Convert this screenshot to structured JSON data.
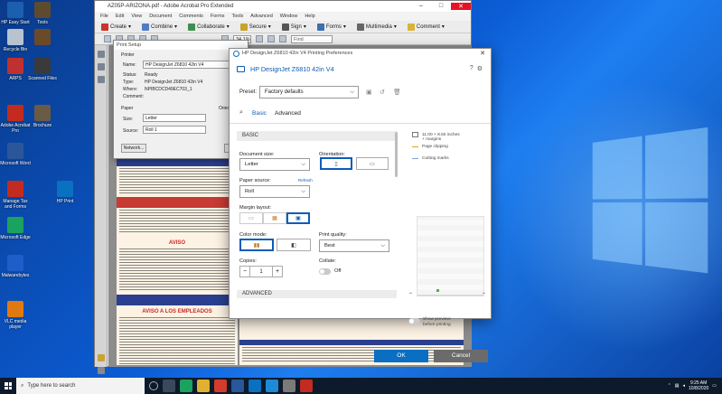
{
  "desktop": {
    "icons": [
      {
        "label": "HP Easy Start",
        "color": "#1c5fb0"
      },
      {
        "label": "Tools",
        "color": "#5e4a2f"
      },
      {
        "label": "Recycle Bin",
        "color": "#b8c3cf"
      },
      {
        "label": "",
        "color": "#6b4a2a"
      },
      {
        "label": "ARPS",
        "color": "#c03030"
      },
      {
        "label": "Scanned Files",
        "color": "#3a3a3a"
      },
      {
        "label": "Adobe Acrobat Pro",
        "color": "#c32b20"
      },
      {
        "label": "Brochure",
        "color": "#6a5b45"
      },
      {
        "label": "Microsoft Word",
        "color": "#2b579a"
      },
      {
        "label": "HP Print",
        "color": "#0a70c2"
      },
      {
        "label": "Manage Tax and Forms",
        "color": "#c32b20"
      },
      {
        "label": "HP Smart",
        "color": "#0a70c2"
      },
      {
        "label": "Microsoft Edge",
        "color": "#1aa260"
      },
      {
        "label": "Malwarebytes",
        "color": "#1d5ec9"
      },
      {
        "label": "VLC media player",
        "color": "#e07a10"
      }
    ]
  },
  "acrobat": {
    "title": "AZ05P-ARIZONA.pdf - Adobe Acrobat Pro Extended",
    "menu": [
      "File",
      "Edit",
      "View",
      "Document",
      "Comments",
      "Forms",
      "Tools",
      "Advanced",
      "Window",
      "Help"
    ],
    "toolbar": [
      "Create",
      "Combine",
      "Collaborate",
      "Secure",
      "Sign",
      "Forms",
      "Multimedia",
      "Comment"
    ],
    "zoom": "34.1%",
    "find_placeholder": "Find",
    "page_title_1": "AVISO",
    "page_title_2": "AVISO A LOS EMPLEADOS"
  },
  "print_setup": {
    "title": "Print Setup",
    "printer_heading": "Printer",
    "name_label": "Name:",
    "name_value": "HP DesignJet Z6810 42in V4",
    "status_label": "Status:",
    "status_value": "Ready",
    "type_label": "Type:",
    "type_value": "HP DesignJet Z6810 42in V4",
    "where_label": "Where:",
    "where_value": "NPIBCDCD49EC703_1",
    "comment_label": "Comment:",
    "paper_heading": "Paper",
    "orientation_heading": "Orient",
    "size_label": "Size:",
    "size_value": "Letter",
    "source_label": "Source:",
    "source_value": "Roll 1",
    "network_button": "Network...",
    "ok_button": "OK"
  },
  "hp_dialog": {
    "window_title": "HP DesignJet Z6810 42in V4 Printing Preferences",
    "header": "HP DesignJet Z6810 42in V4",
    "preset_label": "Preset:",
    "preset_value": "Factory defaults",
    "tab_basic": "Basic",
    "tab_advanced": "Advanced",
    "section_basic": "BASIC",
    "document_size_label": "Document size:",
    "document_size_value": "Letter",
    "orientation_label": "Orientation:",
    "paper_source_label": "Paper source:",
    "refresh_label": "Refresh",
    "paper_source_value": "Roll",
    "margin_layout_label": "Margin layout:",
    "color_mode_label": "Color mode:",
    "print_quality_label": "Print quality:",
    "print_quality_value": "Best",
    "copies_label": "Copies:",
    "copies_value": "1",
    "collate_label": "Collate:",
    "collate_value": "Off",
    "section_advanced": "ADVANCED",
    "preview_size": "11.00 × 8.50 inches",
    "preview_margins": "+ margins",
    "legend_page_clipping": "Page clipping",
    "legend_cutting_marks": "Cutting marks",
    "show_preview_label": "Show preview:",
    "show_preview_sub": "before printing",
    "ok_button": "OK",
    "cancel_button": "Cancel",
    "accent_color": "#0a6fc2"
  },
  "taskbar": {
    "search_placeholder": "Type here to search",
    "time": "9:25 AM",
    "date": "10/8/2020"
  }
}
